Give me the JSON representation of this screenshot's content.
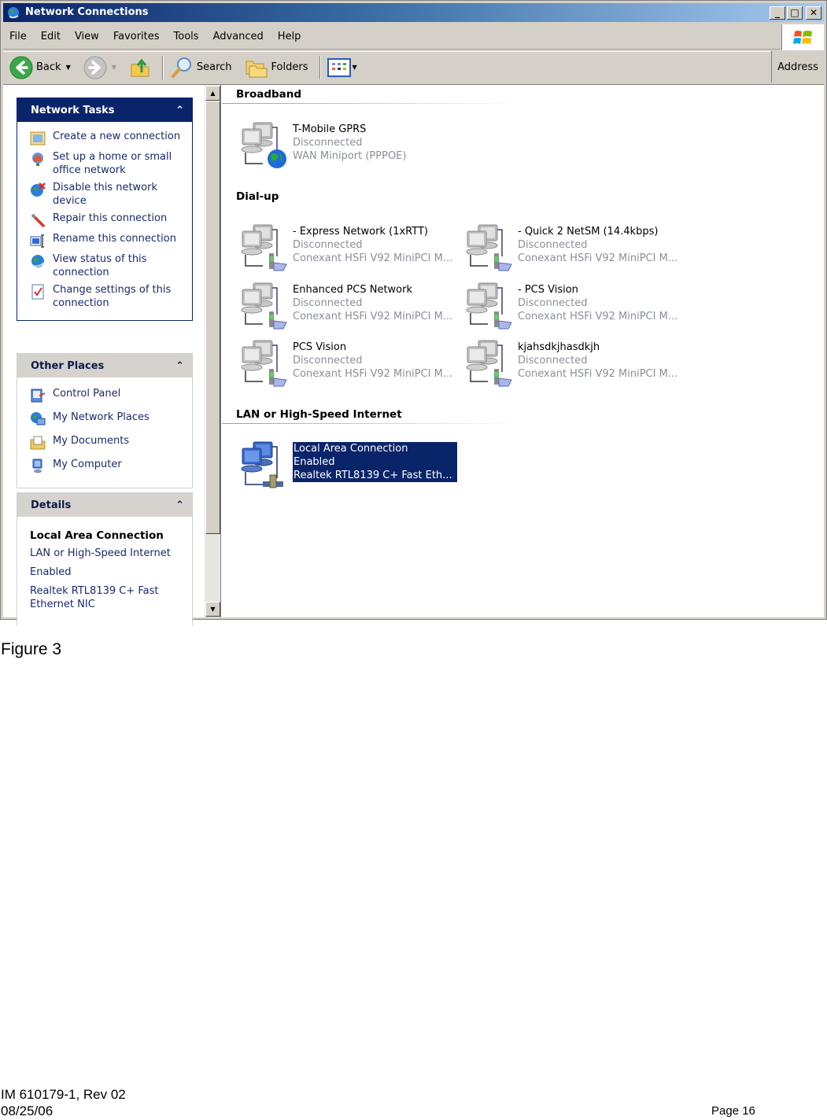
{
  "window": {
    "title": "Network Connections",
    "controls": {
      "minimize": "_",
      "maximize": "□",
      "close": "✕"
    }
  },
  "menu": [
    "File",
    "Edit",
    "View",
    "Favorites",
    "Tools",
    "Advanced",
    "Help"
  ],
  "toolbar": {
    "back": "Back",
    "search": "Search",
    "folders": "Folders",
    "address": "Address"
  },
  "sidebar": {
    "network_tasks": {
      "title": "Network Tasks",
      "items": [
        {
          "label": "Create a new connection",
          "icon": "new-connection-icon"
        },
        {
          "label": "Set up a home or small office network",
          "icon": "home-network-icon"
        },
        {
          "label": "Disable this network device",
          "icon": "disable-device-icon"
        },
        {
          "label": "Repair this connection",
          "icon": "repair-icon"
        },
        {
          "label": "Rename this connection",
          "icon": "rename-icon"
        },
        {
          "label": "View status of this connection",
          "icon": "status-icon"
        },
        {
          "label": "Change settings of this connection",
          "icon": "settings-icon"
        }
      ]
    },
    "other_places": {
      "title": "Other Places",
      "items": [
        {
          "label": "Control Panel",
          "icon": "control-panel-icon"
        },
        {
          "label": "My Network Places",
          "icon": "network-places-icon"
        },
        {
          "label": "My Documents",
          "icon": "documents-icon"
        },
        {
          "label": "My Computer",
          "icon": "computer-icon"
        }
      ]
    },
    "details": {
      "title": "Details",
      "name": "Local Area Connection",
      "type": "LAN or High-Speed Internet",
      "status": "Enabled",
      "device": "Realtek RTL8139 C+ Fast Ethernet NIC"
    }
  },
  "groups": {
    "broadband": {
      "title": "Broadband",
      "items": [
        {
          "name": "T-Mobile GPRS",
          "status": "Disconnected",
          "device": "WAN Miniport (PPPOE)"
        }
      ]
    },
    "dialup": {
      "title": "Dial-up",
      "items": [
        {
          "name": "- Express Network (1xRTT)",
          "status": "Disconnected",
          "device": "Conexant HSFi V92 MiniPCI M..."
        },
        {
          "name": "- Quick 2 NetSM (14.4kbps)",
          "status": "Disconnected",
          "device": "Conexant HSFi V92 MiniPCI M..."
        },
        {
          "name": "Enhanced PCS Network",
          "status": "Disconnected",
          "device": "Conexant HSFi V92 MiniPCI M..."
        },
        {
          "name": "- PCS Vision",
          "status": "Disconnected",
          "device": "Conexant HSFi V92 MiniPCI M..."
        },
        {
          "name": "PCS Vision",
          "status": "Disconnected",
          "device": "Conexant HSFi V92 MiniPCI M..."
        },
        {
          "name": "kjahsdkjhasdkjh",
          "status": "Disconnected",
          "device": "Conexant HSFi V92 MiniPCI M..."
        }
      ]
    },
    "lan": {
      "title": "LAN or High-Speed Internet",
      "items": [
        {
          "name": "Local Area Connection",
          "status": "Enabled",
          "device": "Realtek RTL8139 C+ Fast Eth...",
          "selected": true
        }
      ]
    }
  },
  "document": {
    "caption": "Figure 3",
    "doc_id": "IM 610179-1, Rev 02",
    "date": "08/25/06",
    "page": "Page 16"
  },
  "colors": {
    "title_gradient_start": "#0a246a",
    "title_gradient_end": "#a6caf0",
    "task_pane_header": "#0a246a",
    "selection": "#0a246a",
    "link_text": "#1a2a6c",
    "disabled_text": "#8a8f98"
  }
}
